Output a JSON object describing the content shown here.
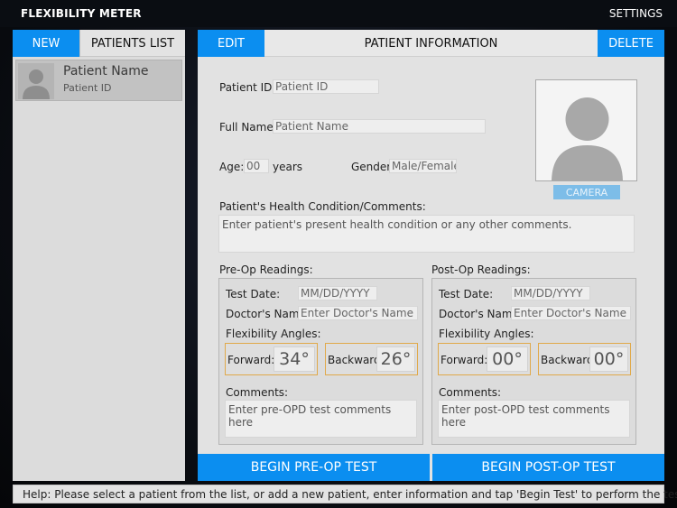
{
  "app": {
    "title": "FLEXIBILITY METER",
    "settings_label": "SETTINGS"
  },
  "colors": {
    "accent": "#0b8ef0",
    "highlight_border": "#e0a94a",
    "camera_button": "#7dbde8"
  },
  "left_panel": {
    "new_label": "NEW",
    "title": "PATIENTS LIST",
    "patients": [
      {
        "name": "Patient Name",
        "id": "Patient ID",
        "avatar_icon": "person-silhouette-icon"
      }
    ]
  },
  "right_panel": {
    "edit_label": "EDIT",
    "title": "PATIENT INFORMATION",
    "delete_label": "DELETE",
    "patient_id": {
      "label": "Patient ID:",
      "value": "Patient ID"
    },
    "full_name": {
      "label": "Full Name:",
      "value": "Patient Name"
    },
    "age": {
      "label": "Age:",
      "value": "00",
      "unit": "years"
    },
    "gender": {
      "label": "Gender:",
      "value": "Male/Female"
    },
    "photo_icon": "person-silhouette-icon",
    "camera_label": "CAMERA",
    "health": {
      "label": "Patient's Health Condition/Comments:",
      "placeholder": "Enter patient's present health condition or any other comments."
    },
    "pre_op": {
      "title": "Pre-Op Readings:",
      "test_date_label": "Test Date:",
      "test_date_value": "MM/DD/YYYY",
      "doctor_label": "Doctor's Name:",
      "doctor_value": "Enter Doctor's Name",
      "angles_label": "Flexibility Angles:",
      "forward_label": "Forward:",
      "forward_value": "34°",
      "backward_label": "Backward:",
      "backward_value": "26°",
      "comments_label": "Comments:",
      "comments_placeholder": "Enter pre-OPD test comments here"
    },
    "post_op": {
      "title": "Post-Op Readings:",
      "test_date_label": "Test Date:",
      "test_date_value": "MM/DD/YYYY",
      "doctor_label": "Doctor's Name:",
      "doctor_value": "Enter Doctor's Name",
      "angles_label": "Flexibility Angles:",
      "forward_label": "Forward:",
      "forward_value": "00°",
      "backward_label": "Backward:",
      "backward_value": "00°",
      "comments_label": "Comments:",
      "comments_placeholder": "Enter post-OPD test comments here"
    },
    "begin_pre_label": "BEGIN PRE-OP TEST",
    "begin_post_label": "BEGIN POST-OP TEST"
  },
  "help": {
    "text": "Help: Please select a patient from the list, or add a new patient, enter information and tap 'Begin Test' to perform the test."
  }
}
